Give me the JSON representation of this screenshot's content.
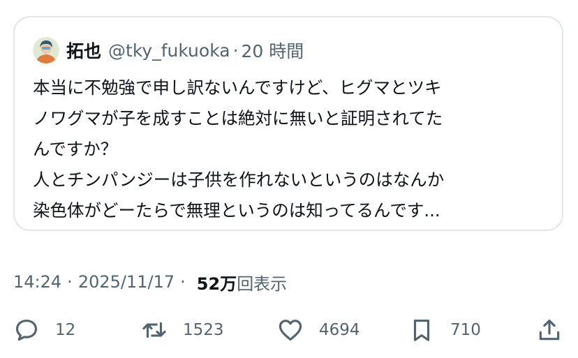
{
  "quote": {
    "author_name": "拓也",
    "author_handle": "@tky_fukuoka",
    "separator": "·",
    "age": "20 時間",
    "lines": [
      "本当に不勉強で申し訳ないんですけど、ヒグマとツキ",
      "ノワグマが子を成すことは絶対に無いと証明されてた",
      "んですか？",
      "人とチンパンジーは子供を作れないというのはなんか",
      "染色体がどーたらで無理というのは知ってるんです..."
    ]
  },
  "meta": {
    "time": "14:24",
    "separator": "·",
    "date": "2025/11/17",
    "views_count": "52万",
    "views_label": "回表示"
  },
  "actions": {
    "reply": {
      "icon": "reply-icon",
      "count": "12"
    },
    "repost": {
      "icon": "repost-icon",
      "count": "1523"
    },
    "like": {
      "icon": "heart-icon",
      "count": "4694"
    },
    "bookmark": {
      "icon": "bookmark-icon",
      "count": "710"
    },
    "share": {
      "icon": "share-icon"
    }
  },
  "colors": {
    "text": "#0f1419",
    "secondary": "#536471",
    "border": "#e3e6e9"
  }
}
